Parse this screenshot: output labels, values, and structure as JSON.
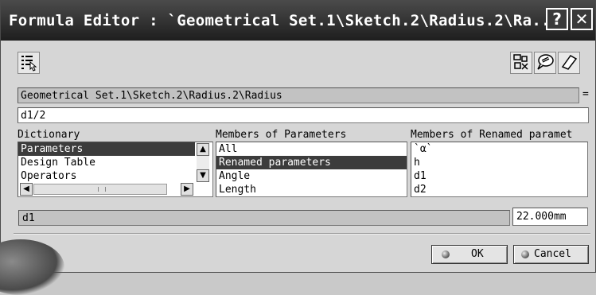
{
  "window": {
    "title": "Formula Editor : `Geometrical Set.1\\Sketch.2\\Radius.2\\Ra...",
    "help_label": "?",
    "close_label": "✕"
  },
  "toolbar": {
    "left_icon": "formula-list-icon",
    "right_icons": [
      "measure-icon",
      "comment-icon",
      "erase-icon"
    ]
  },
  "parameter_path": "Geometrical Set.1\\Sketch.2\\Radius.2\\Radius",
  "equals_sign": "=",
  "formula_value": "d1/2",
  "dictionary": {
    "header": "Dictionary",
    "items": [
      "Parameters",
      "Design Table",
      "Operators"
    ],
    "selected_index": 0
  },
  "members": {
    "header": "Members of Parameters",
    "items": [
      "All",
      "Renamed parameters",
      "Angle",
      "Length"
    ],
    "selected_index": 1
  },
  "renamed": {
    "header": "Members of Renamed paramet",
    "items": [
      "`α`",
      "h",
      "d1",
      "d2"
    ]
  },
  "selected_param": {
    "name": "d1",
    "value": "22.000mm"
  },
  "buttons": {
    "ok": "OK",
    "cancel": "Cancel"
  },
  "colors": {
    "titlebar": "#1e1e1e",
    "selection": "#3c3c3c",
    "dialog_bg": "#d6d6d6"
  }
}
